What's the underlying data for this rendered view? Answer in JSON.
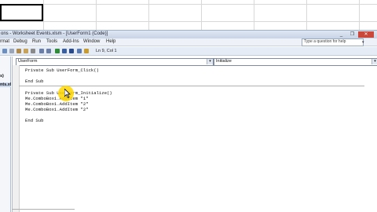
{
  "window": {
    "title": "ons - Worksheet Events.xlsm - [UserForm1 (Code)]",
    "controls": [
      "_",
      "❐",
      "✕"
    ]
  },
  "menubar": {
    "items": [
      "rmat",
      "Debug",
      "Run",
      "Tools",
      "Add-Ins",
      "Window",
      "Help"
    ],
    "help_search_placeholder": "Type a question for help",
    "help_dropdown": "▾"
  },
  "toolbar": {
    "cursor_position": "Ln 9, Col 1"
  },
  "project_pane": {
    "item_label": "s)",
    "item2_label": "nts.xl"
  },
  "code_window": {
    "object_combo": "UserForm",
    "procedure_combo": "Initialize",
    "combo_arrow": "▾",
    "lines": [
      "Private Sub UserForm_Click()",
      "",
      "End Sub",
      "Private Sub UserForm_Initialize()",
      "Me.ComboBox1.AddItem \"1\"",
      "Me.ComboBox1.AddItem \"2\"",
      "Me.ComboBox1.AddItem \"2\"",
      "",
      "End Sub"
    ]
  },
  "colors": {
    "title_gradient_top": "#dfe7f2",
    "close_button": "#c9483b",
    "cursor_highlight": "#ffd700"
  }
}
